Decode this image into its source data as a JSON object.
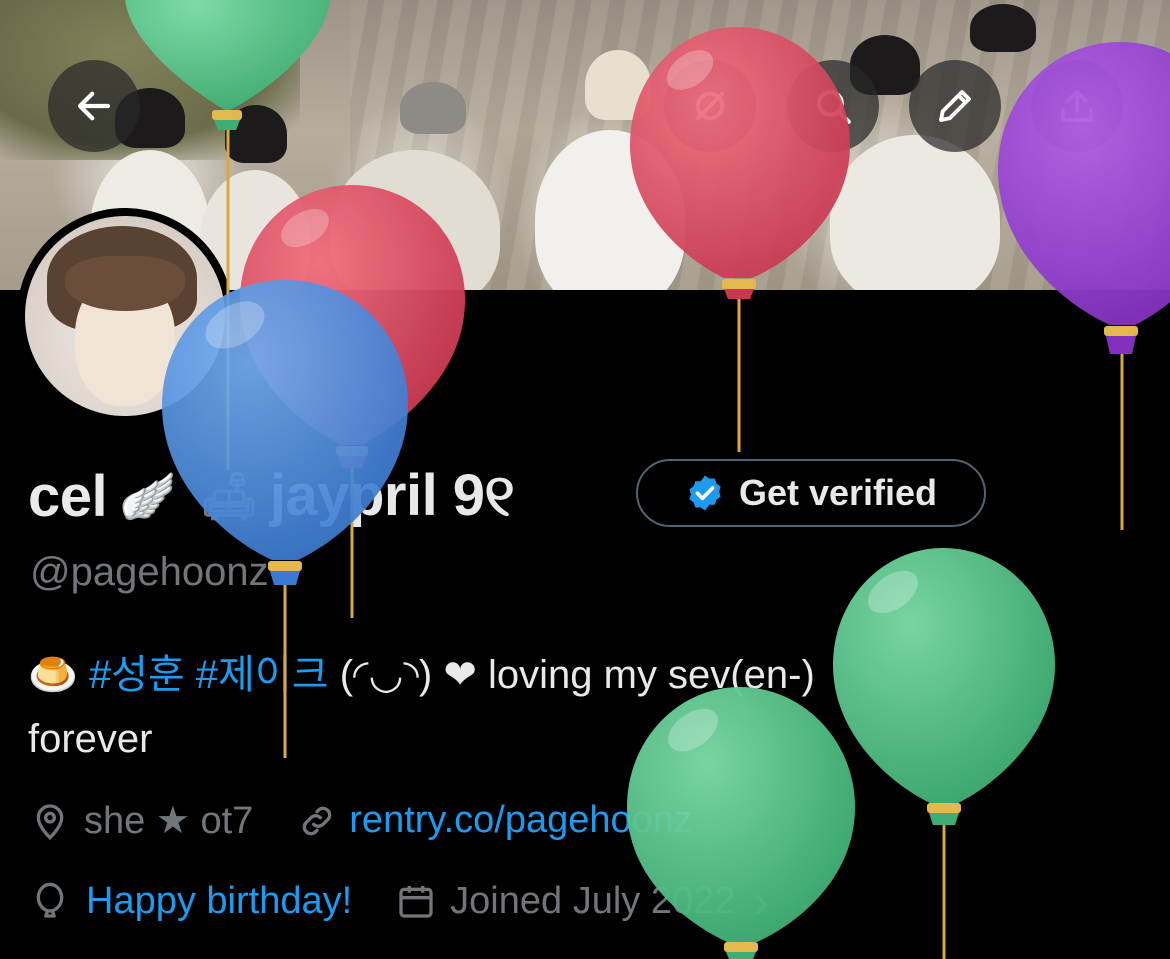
{
  "header": {
    "back_icon": "back-arrow-icon",
    "grok_icon": "grok-icon",
    "search_icon": "search-icon",
    "edit_icon": "pencil-icon",
    "share_icon": "share-icon"
  },
  "profile": {
    "display_name_part1": "cel",
    "emoji_wing": "🪽",
    "emoji_sofa": "🛋",
    "display_name_part2": "jaypril 9୧",
    "get_verified_label": "Get verified",
    "verified_icon": "verified-badge-icon",
    "handle": "@pagehoonz",
    "bio": {
      "emoji_pudding": "🍮",
      "tag1": "#성훈",
      "tag2": "#제이크",
      "text1": "(◜◡◝)",
      "heart": "❤",
      "text2": "loving my sev(en-)",
      "text3": "forever"
    },
    "location": "she ★ ot7",
    "location_icon": "location-pin-icon",
    "link": "rentry.co/pagehoonz",
    "link_icon": "link-icon",
    "birthday": "Happy birthday!",
    "birthday_icon": "balloon-icon",
    "joined": "Joined July 2022",
    "joined_icon": "calendar-icon",
    "joined_chevron": "›"
  },
  "colors": {
    "accent": "#1d9bf0",
    "muted": "#71767b",
    "balloon_green": "#5cc98f",
    "balloon_red": "#e04c65",
    "balloon_blue": "#4f93e0",
    "balloon_purple": "#9b3fd3"
  }
}
